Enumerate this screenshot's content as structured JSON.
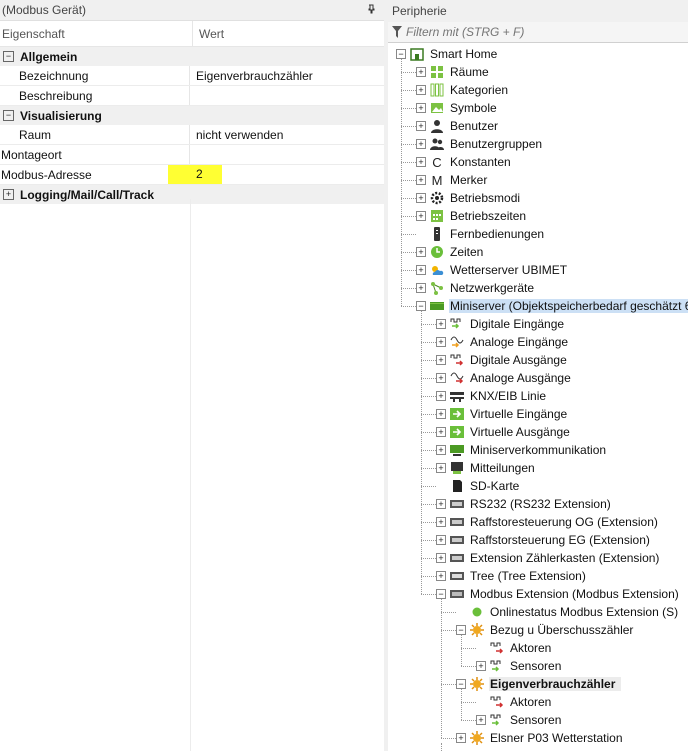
{
  "props": {
    "title": "(Modbus Gerät)",
    "col_key": "Eigenschaft",
    "col_value": "Wert",
    "rows": [
      {
        "type": "cat",
        "label": "Allgemein",
        "exp": "−"
      },
      {
        "type": "prop",
        "key": "Bezeichnung",
        "value": "Eigenverbrauchzähler",
        "indent": true
      },
      {
        "type": "prop",
        "key": "Beschreibung",
        "value": "",
        "indent": true
      },
      {
        "type": "cat",
        "label": "Visualisierung",
        "exp": "−"
      },
      {
        "type": "prop",
        "key": "Raum",
        "value": "nicht verwenden",
        "indent": true
      },
      {
        "type": "prop",
        "key": "Montageort",
        "value": "",
        "indent": false
      },
      {
        "type": "prop",
        "key": "Modbus-Adresse",
        "value": "2",
        "indent": false,
        "highlight": true
      },
      {
        "type": "cat",
        "label": "Logging/Mail/Call/Track",
        "exp": "+"
      }
    ]
  },
  "peri": {
    "title": "Peripherie",
    "filter_placeholder": "Filtern mit (STRG + F)",
    "nodes": [
      {
        "lvl": 0,
        "exp": "−",
        "icon": "home-icon",
        "label": "Smart Home"
      },
      {
        "lvl": 1,
        "exp": "+",
        "icon": "rooms-icon",
        "label": "Räume"
      },
      {
        "lvl": 1,
        "exp": "+",
        "icon": "categories-icon",
        "label": "Kategorien"
      },
      {
        "lvl": 1,
        "exp": "+",
        "icon": "symbols-icon",
        "label": "Symbole"
      },
      {
        "lvl": 1,
        "exp": "+",
        "icon": "user-icon",
        "label": "Benutzer"
      },
      {
        "lvl": 1,
        "exp": "+",
        "icon": "usergroup-icon",
        "label": "Benutzergruppen"
      },
      {
        "lvl": 1,
        "exp": "+",
        "icon": "constant-icon",
        "label": "Konstanten"
      },
      {
        "lvl": 1,
        "exp": "+",
        "icon": "marker-icon",
        "label": "Merker"
      },
      {
        "lvl": 1,
        "exp": "+",
        "icon": "gear-icon",
        "label": "Betriebsmodi"
      },
      {
        "lvl": 1,
        "exp": "+",
        "icon": "calendar-icon",
        "label": "Betriebszeiten"
      },
      {
        "lvl": 1,
        "exp": "",
        "icon": "remote-icon",
        "label": "Fernbedienungen"
      },
      {
        "lvl": 1,
        "exp": "+",
        "icon": "clock-icon",
        "label": "Zeiten"
      },
      {
        "lvl": 1,
        "exp": "+",
        "icon": "weather-icon",
        "label": "Wetterserver UBIMET"
      },
      {
        "lvl": 1,
        "exp": "+",
        "icon": "network-icon",
        "label": "Netzwerkgeräte"
      },
      {
        "lvl": 1,
        "exp": "−",
        "icon": "miniserver-icon",
        "label": "Miniserver (Objektspeicherbedarf geschätzt 6",
        "selected": true
      },
      {
        "lvl": 2,
        "exp": "+",
        "icon": "digital-input-icon",
        "label": "Digitale Eingänge"
      },
      {
        "lvl": 2,
        "exp": "+",
        "icon": "analog-input-icon",
        "label": "Analoge Eingänge"
      },
      {
        "lvl": 2,
        "exp": "+",
        "icon": "digital-output-icon",
        "label": "Digitale Ausgänge"
      },
      {
        "lvl": 2,
        "exp": "+",
        "icon": "analog-output-icon",
        "label": "Analoge Ausgänge"
      },
      {
        "lvl": 2,
        "exp": "+",
        "icon": "knx-icon",
        "label": "KNX/EIB Linie"
      },
      {
        "lvl": 2,
        "exp": "+",
        "icon": "virtual-input-icon",
        "label": "Virtuelle Eingänge"
      },
      {
        "lvl": 2,
        "exp": "+",
        "icon": "virtual-output-icon",
        "label": "Virtuelle Ausgänge"
      },
      {
        "lvl": 2,
        "exp": "+",
        "icon": "miniserver-comm-icon",
        "label": "Miniserverkommunikation"
      },
      {
        "lvl": 2,
        "exp": "+",
        "icon": "messages-icon",
        "label": "Mitteilungen"
      },
      {
        "lvl": 2,
        "exp": "",
        "icon": "sdcard-icon",
        "label": "SD-Karte"
      },
      {
        "lvl": 2,
        "exp": "+",
        "icon": "extension-icon",
        "label": "RS232 (RS232 Extension)"
      },
      {
        "lvl": 2,
        "exp": "+",
        "icon": "extension-icon",
        "label": "Raffstoresteuerung OG (Extension)"
      },
      {
        "lvl": 2,
        "exp": "+",
        "icon": "extension-icon",
        "label": "Raffstorsteuerung EG (Extension)"
      },
      {
        "lvl": 2,
        "exp": "+",
        "icon": "extension-icon",
        "label": "Extension Zählerkasten (Extension)"
      },
      {
        "lvl": 2,
        "exp": "+",
        "icon": "tree-extension-icon",
        "label": "Tree (Tree Extension)"
      },
      {
        "lvl": 2,
        "exp": "−",
        "icon": "modbus-extension-icon",
        "label": "Modbus Extension (Modbus Extension)"
      },
      {
        "lvl": 3,
        "exp": "",
        "icon": "online-status-icon",
        "label": "Onlinestatus Modbus Extension (S)"
      },
      {
        "lvl": 3,
        "exp": "−",
        "icon": "device-icon",
        "label": "Bezug u Überschusszähler"
      },
      {
        "lvl": 4,
        "exp": "",
        "icon": "actuators-icon",
        "label": "Aktoren"
      },
      {
        "lvl": 4,
        "exp": "+",
        "icon": "sensors-icon",
        "label": "Sensoren"
      },
      {
        "lvl": 3,
        "exp": "−",
        "icon": "device-icon",
        "label": "Eigenverbrauchzähler",
        "bold": true
      },
      {
        "lvl": 4,
        "exp": "",
        "icon": "actuators-icon",
        "label": "Aktoren"
      },
      {
        "lvl": 4,
        "exp": "+",
        "icon": "sensors-icon",
        "label": "Sensoren"
      },
      {
        "lvl": 3,
        "exp": "+",
        "icon": "device-icon",
        "label": "Elsner P03 Wetterstation"
      }
    ]
  }
}
